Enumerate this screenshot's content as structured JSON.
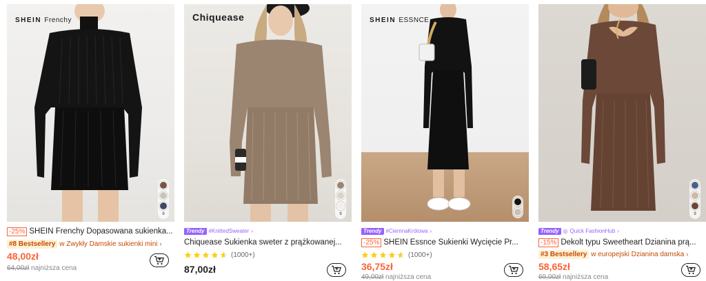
{
  "products": [
    {
      "brand_logo": "SHEIN",
      "brand_logo_sub": "Frenchy",
      "discount": "-25%",
      "title": "SHEIN Frenchy Dopasowana sukienka...",
      "bestseller": "#8 Bestsellery",
      "bestseller_category": "w Zwykły Damskie sukienki mini",
      "price": "48,00zł",
      "original_price": "64,00zł",
      "lowest_label": "najniższa cena",
      "swatch_count": "9",
      "swatches": [
        "#7a5545",
        "#c9c4bb",
        "#3d4a63"
      ]
    },
    {
      "brand_logo": "Chiquease",
      "trendy_label": "Trendy",
      "trendy_tag": "#KnittedSweater",
      "title": "Chiquease Sukienka sweter z prążkowanej...",
      "rating_count": "(1000+)",
      "price": "87,00zł",
      "swatch_count": "9",
      "swatches": [
        "#9a8570",
        "#d9d3c8",
        "#f1efec"
      ]
    },
    {
      "brand_logo": "SHEIN",
      "brand_logo_sub": "ESSNCE",
      "trendy_label": "Trendy",
      "trendy_tag": "#CiemnaKrólowa",
      "discount": "-25%",
      "title": "SHEIN Essnce Sukienki Wycięcie Pr...",
      "rating_count": "(1000+)",
      "price": "36,75zł",
      "original_price": "49,00zł",
      "lowest_label": "najniższa cena",
      "swatches": [
        "#111111",
        "#c7c2b8"
      ]
    },
    {
      "trendy_label": "Trendy",
      "trendy_tag": "Quick FashionHub",
      "discount": "-15%",
      "title": "Dekolt typu Sweetheart Dzianina prą...",
      "bestseller": "#3 Bestsellery",
      "bestseller_category": "w europejski Dzianina damska",
      "price": "58,65zł",
      "original_price": "69,00zł",
      "lowest_label": "najniższa cena",
      "swatch_count": "9",
      "swatches": [
        "#4c6086",
        "#cdb8a2",
        "#6a4636"
      ]
    }
  ],
  "icons": {
    "cart": "add-to-cart-icon",
    "star": "star-icon",
    "chevron": "chevron-right-icon"
  },
  "colors": {
    "sale": "#fa6338",
    "trendy": "#9462ff",
    "bestseller_bg": "#fff1d4",
    "bestseller_text": "#c44a01"
  }
}
